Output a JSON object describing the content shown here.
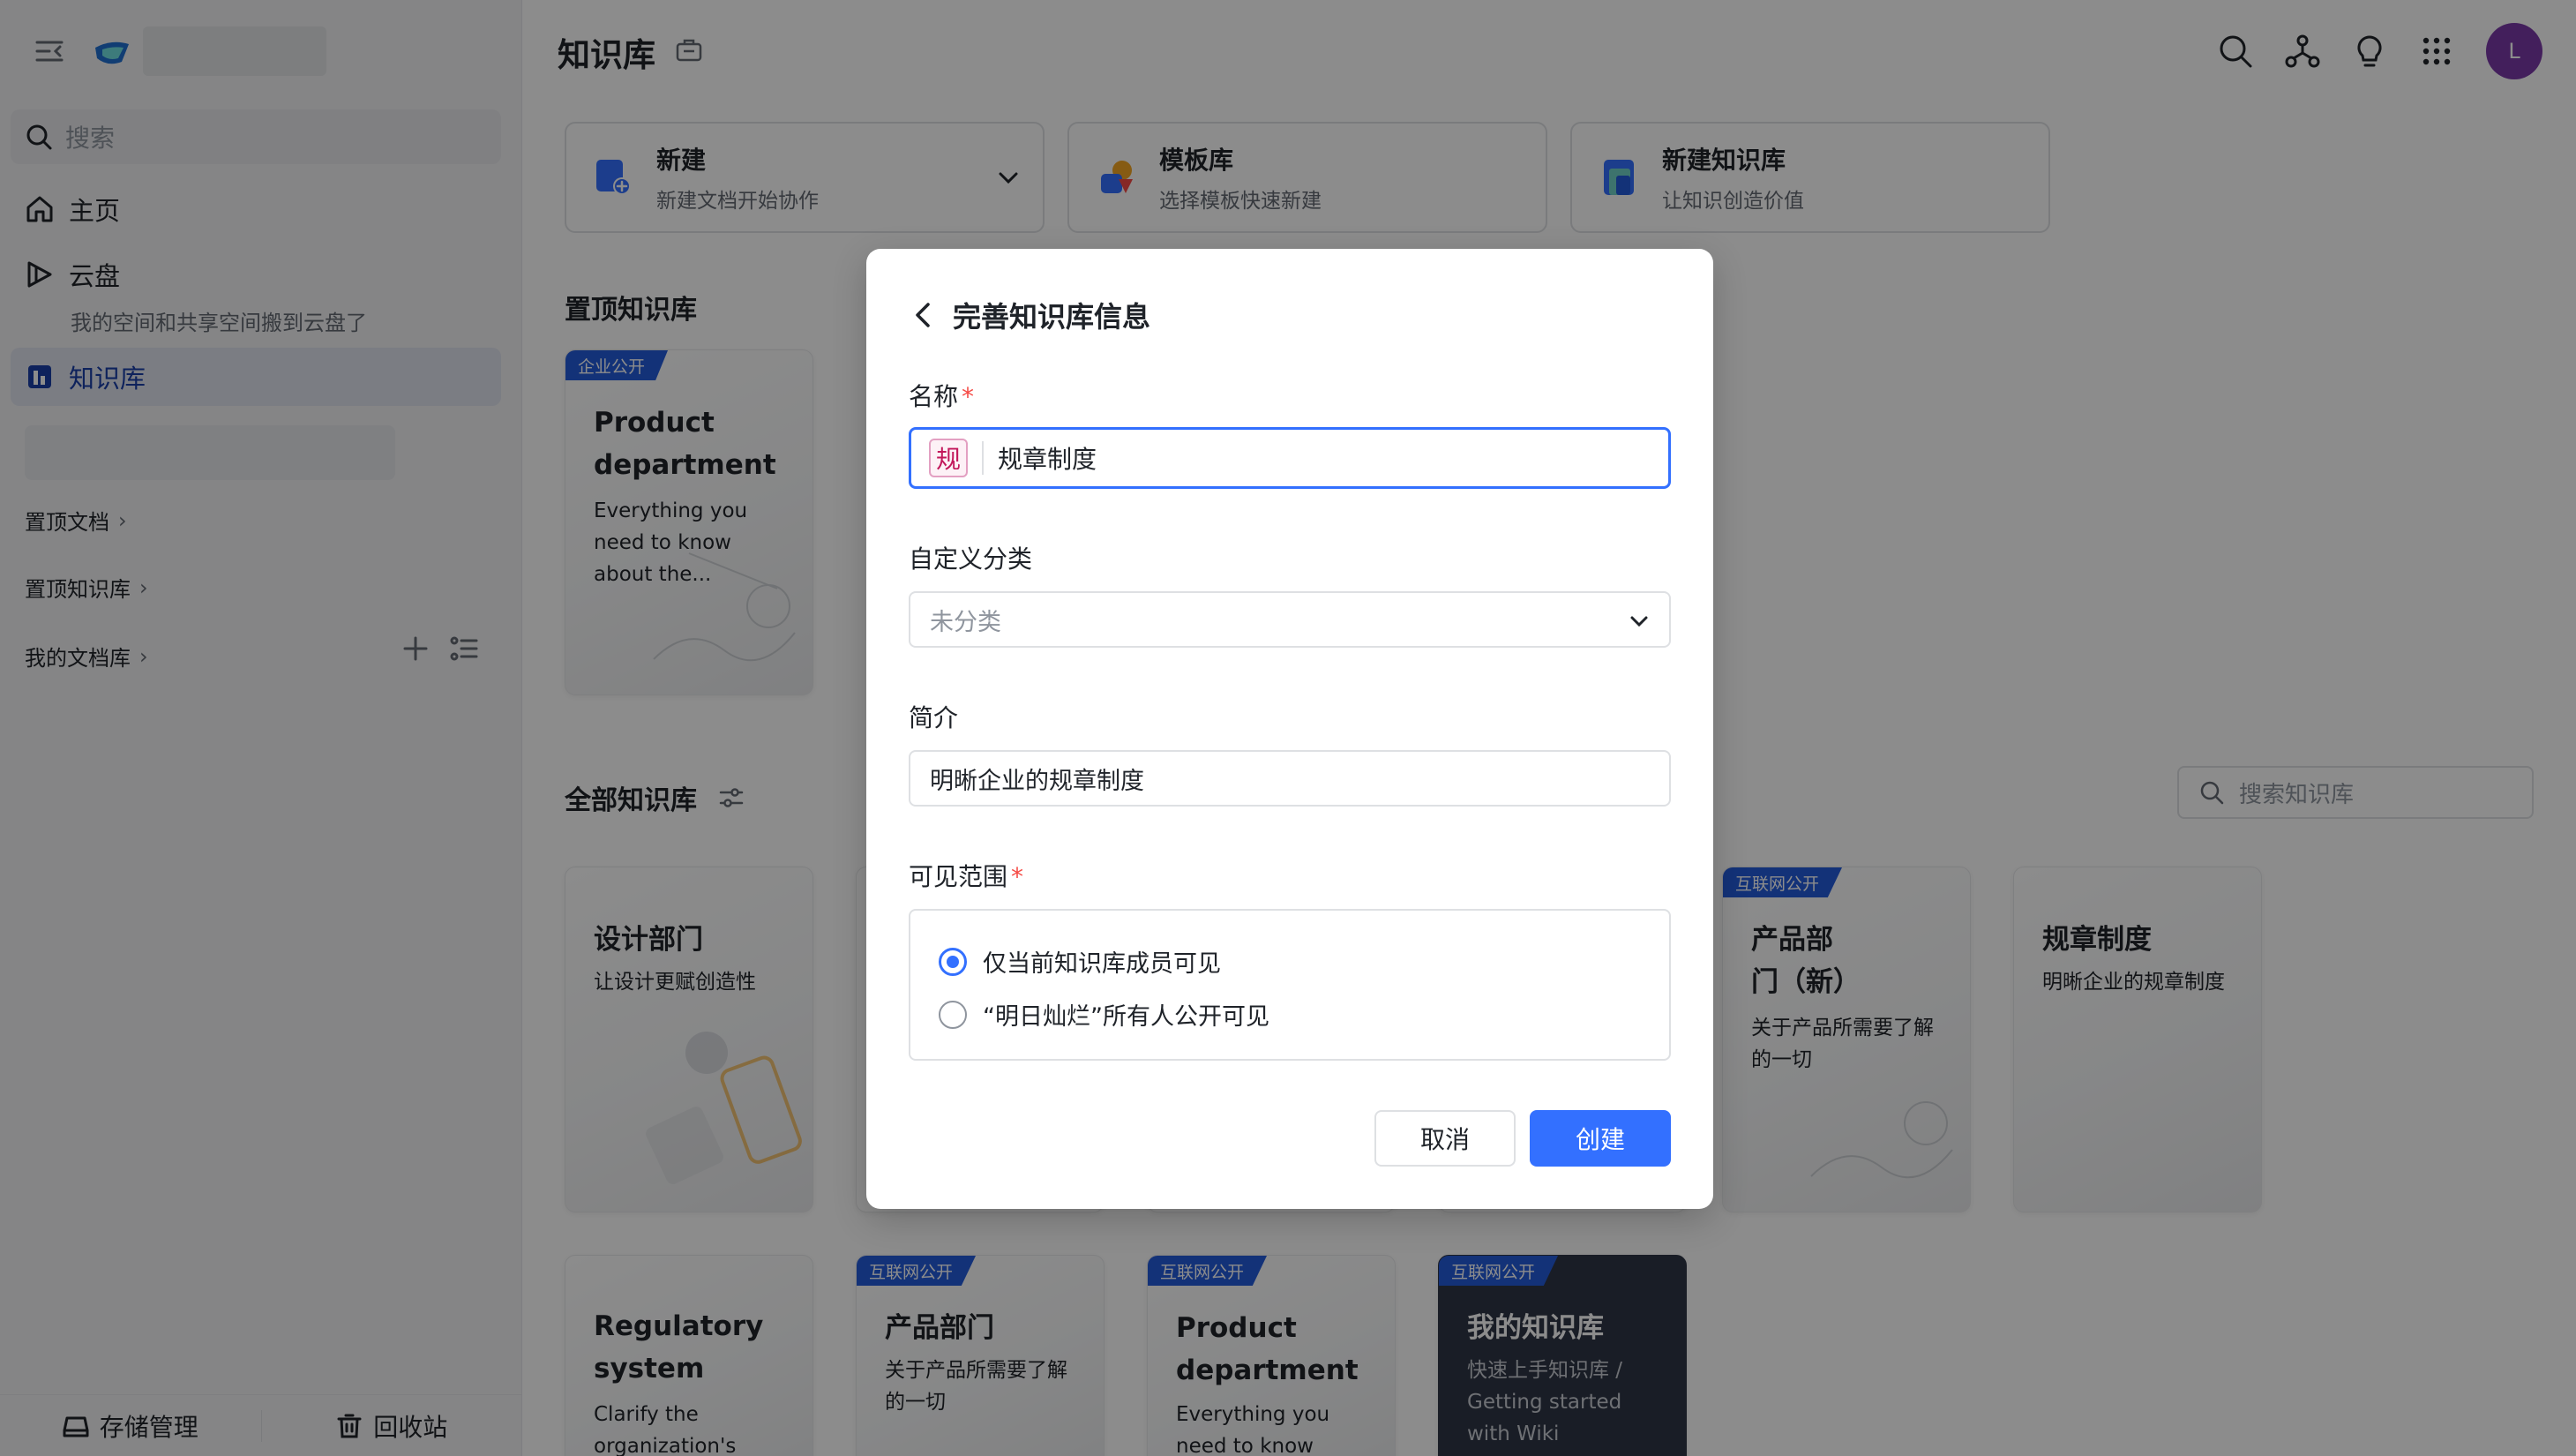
{
  "sidebar": {
    "search_placeholder": "搜索",
    "items": {
      "home": "主页",
      "cloud": "云盘",
      "cloud_sub": "我的空间和共享空间搬到云盘了",
      "wiki": "知识库"
    },
    "sections": {
      "pinned_docs": "置顶文档",
      "pinned_wikis": "置顶知识库",
      "my_library": "我的文档库"
    },
    "bottom": {
      "storage": "存储管理",
      "trash": "回收站"
    }
  },
  "header": {
    "title": "知识库",
    "avatar_letter": "L"
  },
  "quick_actions": [
    {
      "title": "新建",
      "subtitle": "新建文档开始协作"
    },
    {
      "title": "模板库",
      "subtitle": "选择模板快速新建"
    },
    {
      "title": "新建知识库",
      "subtitle": "让知识创造价值"
    }
  ],
  "pinned": {
    "title": "置顶知识库",
    "cards": [
      {
        "badge": "企业公开",
        "title": "Product department",
        "desc": "Everything you need to know about the..."
      }
    ]
  },
  "all": {
    "title": "全部知识库",
    "search_placeholder": "搜索知识库",
    "cards": [
      {
        "badge": "",
        "title": "设计部门",
        "desc": "让设计更赋创造性"
      },
      {
        "badge": "互联网公开",
        "title": "产品部门（新）",
        "desc": "关于产品所需要了解的一切"
      },
      {
        "badge": "",
        "title": "规章制度",
        "desc": "明晰企业的规章制度"
      },
      {
        "badge": "",
        "title": "Regulatory system",
        "desc": "Clarify the organization's"
      },
      {
        "badge": "互联网公开",
        "title": "产品部门",
        "desc": "关于产品所需要了解的一切"
      },
      {
        "badge": "互联网公开",
        "title": "Product department",
        "desc": "Everything you need to know"
      },
      {
        "badge": "互联网公开",
        "title": "我的知识库",
        "desc": "快速上手知识库 / Getting started with Wiki"
      }
    ]
  },
  "modal": {
    "title": "完善知识库信息",
    "name_label": "名称",
    "required_mark": "*",
    "name_chip": "规",
    "name_value": "规章制度",
    "category_label": "自定义分类",
    "category_value": "未分类",
    "intro_label": "简介",
    "intro_value": "明晰企业的规章制度",
    "visibility_label": "可见范围",
    "visibility_options": [
      {
        "label": "仅当前知识库成员可见",
        "selected": true
      },
      {
        "label": "“明日灿烂”所有人公开可见",
        "selected": false
      }
    ],
    "cancel": "取消",
    "create": "创建"
  },
  "colors": {
    "accent": "#3370ff",
    "badge": "#245bdb",
    "avatar": "#7a3aa8",
    "required": "#f54a45"
  }
}
